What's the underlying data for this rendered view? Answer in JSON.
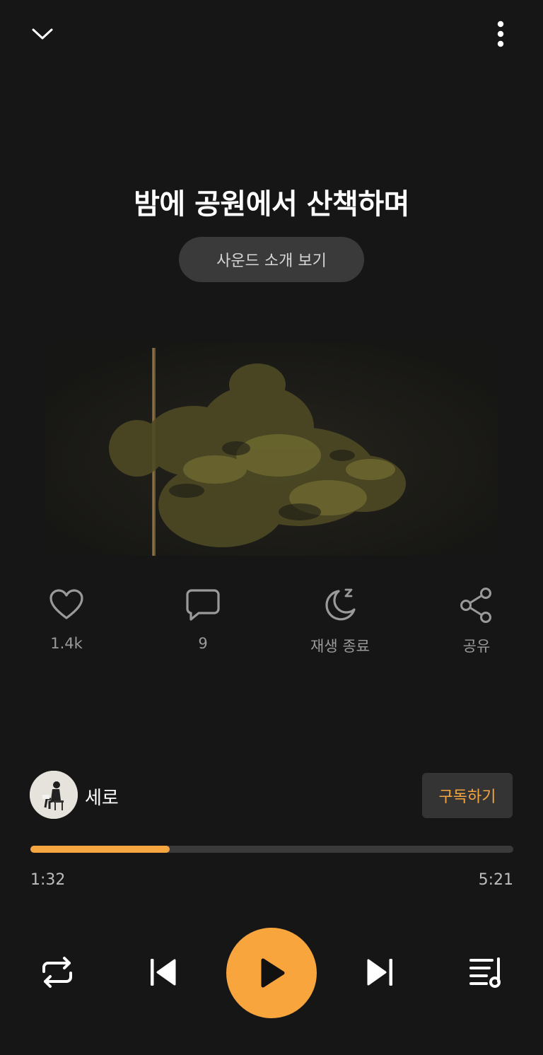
{
  "header": {
    "collapse_icon": "chevron-down-icon",
    "more_icon": "more-vertical-icon"
  },
  "track": {
    "title": "밤에 공원에서 산책하며",
    "intro_button_label": "사운드 소개 보기"
  },
  "actions": [
    {
      "icon": "heart-icon",
      "label": "1.4k"
    },
    {
      "icon": "comment-icon",
      "label": "9"
    },
    {
      "icon": "sleep-timer-icon",
      "label": "재생 종료"
    },
    {
      "icon": "share-icon",
      "label": "공유"
    }
  ],
  "creator": {
    "name": "세로",
    "subscribe_label": "구독하기"
  },
  "playback": {
    "current_time": "1:32",
    "total_time": "5:21",
    "progress_fraction": 0.288
  },
  "controls": {
    "repeat_icon": "repeat-icon",
    "previous_icon": "skip-previous-icon",
    "play_icon": "play-icon",
    "next_icon": "skip-next-icon",
    "playlist_icon": "playlist-icon"
  },
  "colors": {
    "background": "#161616",
    "accent": "#f8a53e",
    "muted_text": "#9a9a9a",
    "button_bg": "#3a3a3a"
  }
}
